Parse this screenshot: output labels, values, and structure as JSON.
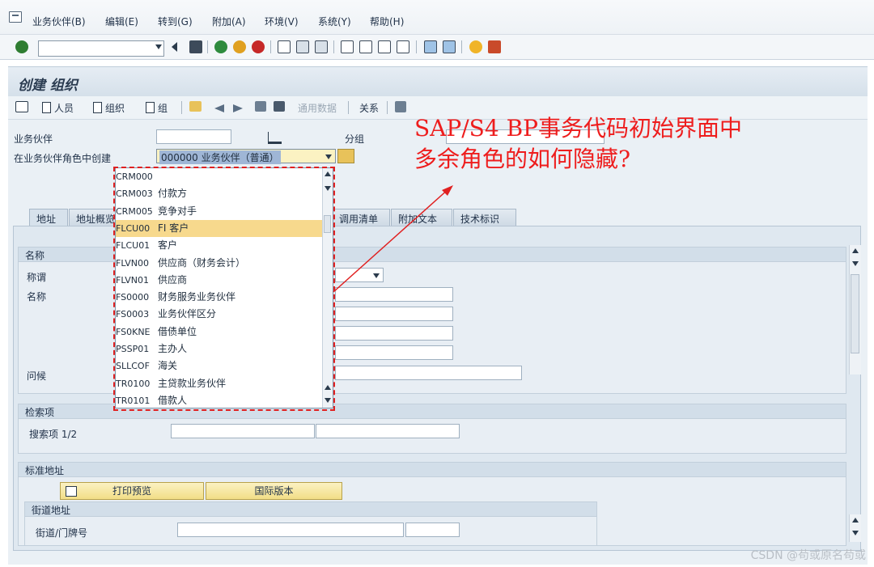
{
  "menubar": {
    "items": [
      "业务伙伴(B)",
      "编辑(E)",
      "转到(G)",
      "附加(A)",
      "环境(V)",
      "系统(Y)",
      "帮助(H)"
    ]
  },
  "window": {
    "title": "创建 组织"
  },
  "app_toolbar": {
    "person": "人员",
    "organization": "组织",
    "group": "组",
    "general_data": "通用数据",
    "relations": "关系"
  },
  "form": {
    "bp_label": "业务伙伴",
    "grouping_label": "分组",
    "role_label": "在业务伙伴角色中创建",
    "role_value": "000000 业务伙伴（普通）"
  },
  "tabs": [
    "地址",
    "地址概览",
    "调用清单",
    "附加文本",
    "技术标识"
  ],
  "sections": {
    "name": {
      "title": "名称",
      "salutation": "称谓",
      "name": "名称",
      "greeting": "问候"
    },
    "search": {
      "title": "检索项",
      "term": "搜索项 1/2"
    },
    "std_address": {
      "title": "标准地址",
      "print_preview": "打印预览",
      "intl_version": "国际版本"
    },
    "street": {
      "title": "街道地址",
      "street_no": "街道/门牌号"
    }
  },
  "dropdown": {
    "items": [
      {
        "code": "CRM000",
        "desc": ""
      },
      {
        "code": "CRM003",
        "desc": "付款方"
      },
      {
        "code": "CRM005",
        "desc": "竞争对手"
      },
      {
        "code": "FLCU00",
        "desc": "FI 客户",
        "selected": true
      },
      {
        "code": "FLCU01",
        "desc": "客户"
      },
      {
        "code": "FLVN00",
        "desc": "供应商（财务会计）"
      },
      {
        "code": "FLVN01",
        "desc": "供应商"
      },
      {
        "code": "FS0000",
        "desc": "财务服务业务伙伴"
      },
      {
        "code": "FS0003",
        "desc": "业务伙伴区分"
      },
      {
        "code": "FS0KNE",
        "desc": "借债单位"
      },
      {
        "code": "PSSP01",
        "desc": "主办人"
      },
      {
        "code": "SLLCOF",
        "desc": "海关"
      },
      {
        "code": "TR0100",
        "desc": "主贷款业务伙伴"
      },
      {
        "code": "TR0101",
        "desc": "借款人"
      }
    ]
  },
  "annotation": {
    "line1": "SAP/S4 BP事务代码初始界面中",
    "line2": "多余角色的如何隐藏?"
  },
  "watermark": "CSDN @苟或原名苟或",
  "colors": {
    "highlight": "#f7d98d",
    "annotation": "#ee1d1d"
  }
}
